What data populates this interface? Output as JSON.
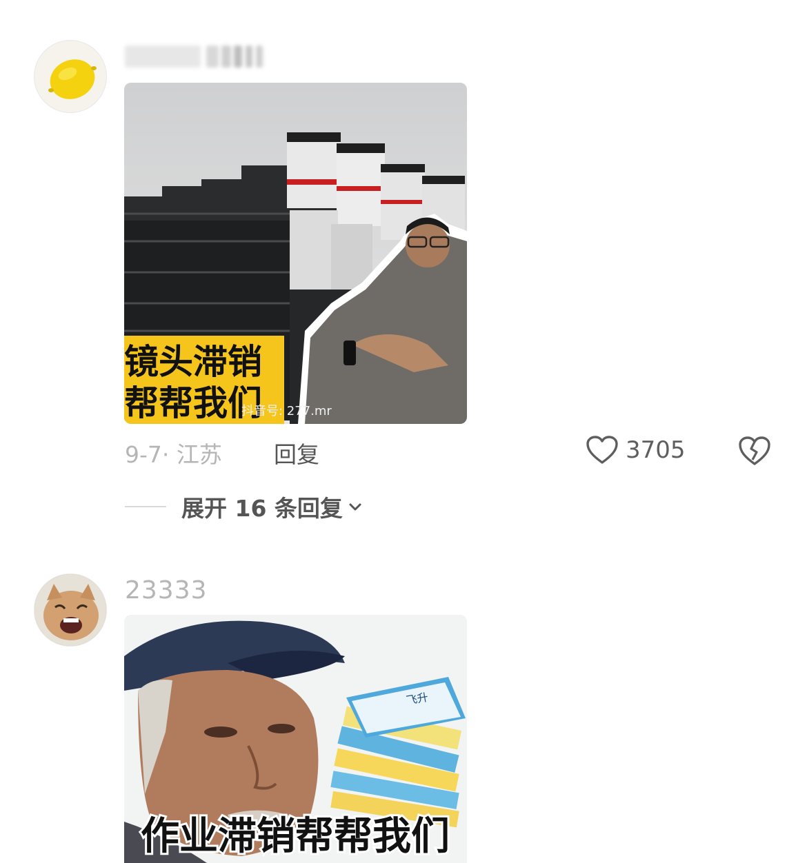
{
  "comments": [
    {
      "username": "",
      "avatar_icon": "lemon-icon",
      "image": {
        "overlay_line1": "镜头滞销",
        "overlay_line2": "帮帮我们",
        "watermark": "抖音号: 277.mr"
      },
      "date_location": "9-7· 江苏",
      "reply_label": "回复",
      "like_count": "3705",
      "expand_label": "展开 16 条回复",
      "colors": {
        "overlay_bg": "#f5c51c"
      }
    },
    {
      "username": "23333",
      "avatar_icon": "laughing-cat-icon",
      "image": {
        "caption": "作业滞销帮帮我们",
        "book_label": "飞升"
      }
    }
  ]
}
